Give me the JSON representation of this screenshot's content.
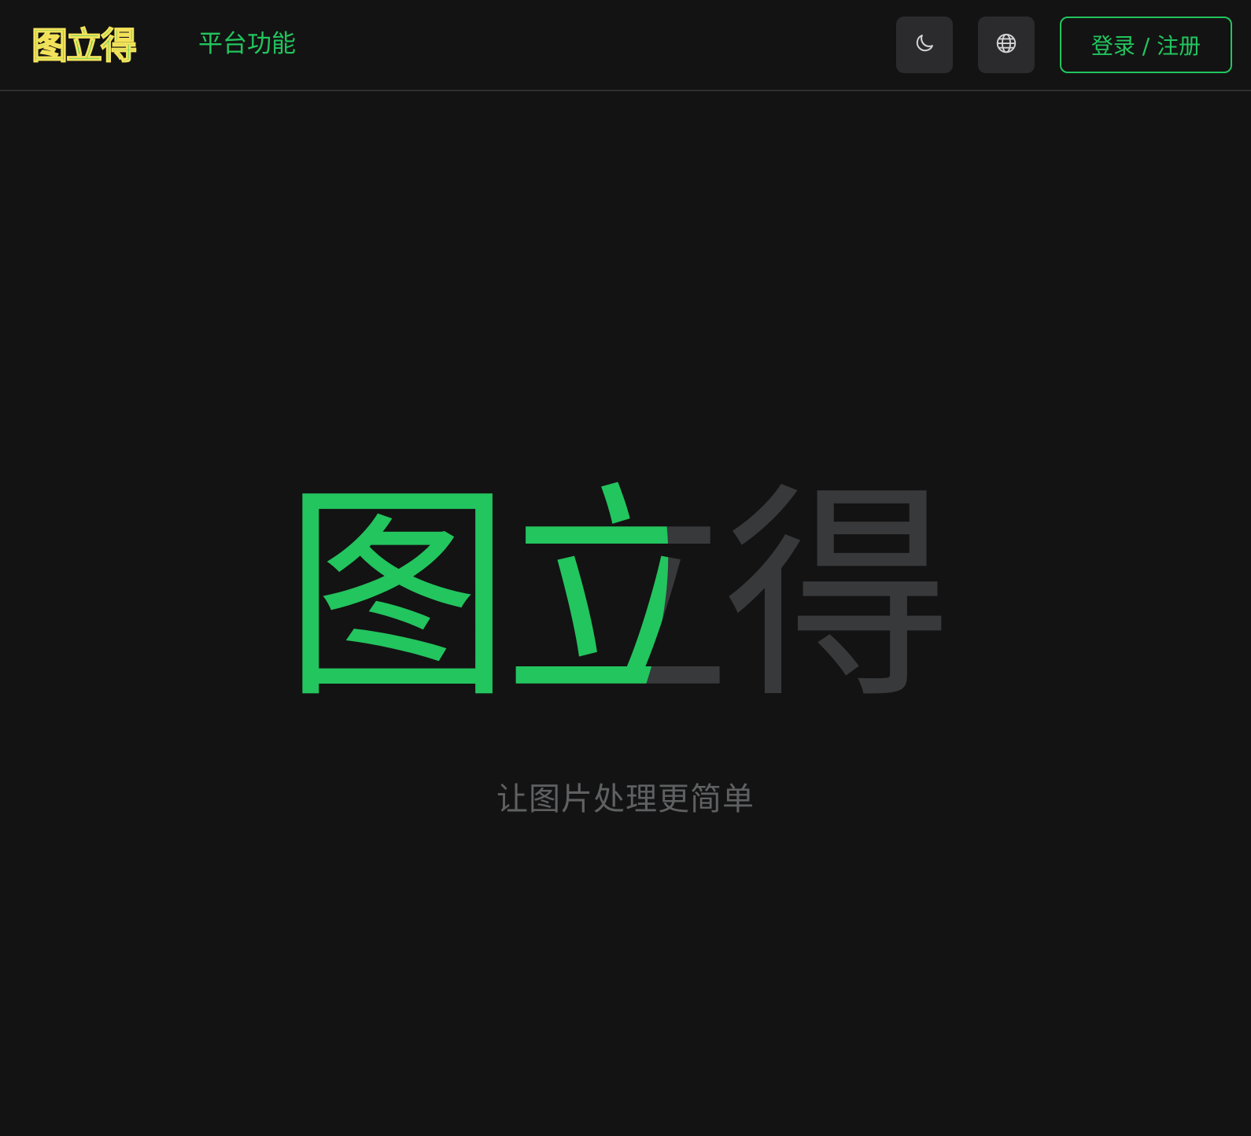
{
  "header": {
    "logo_text": "图立得",
    "nav_link": "平台功能",
    "theme_toggle_icon": "moon-icon",
    "language_icon": "globe-icon",
    "login_label": "登录 / 注册"
  },
  "hero": {
    "title_chars": [
      "图",
      "立",
      "得"
    ],
    "tagline": "让图片处理更简单"
  },
  "colors": {
    "background": "#131313",
    "accent": "#22c55e",
    "muted_title": "#38393b",
    "tagline": "#5f6062",
    "icon_button_bg": "#2b2b2d",
    "logo_yellow": "#f4e35a"
  }
}
